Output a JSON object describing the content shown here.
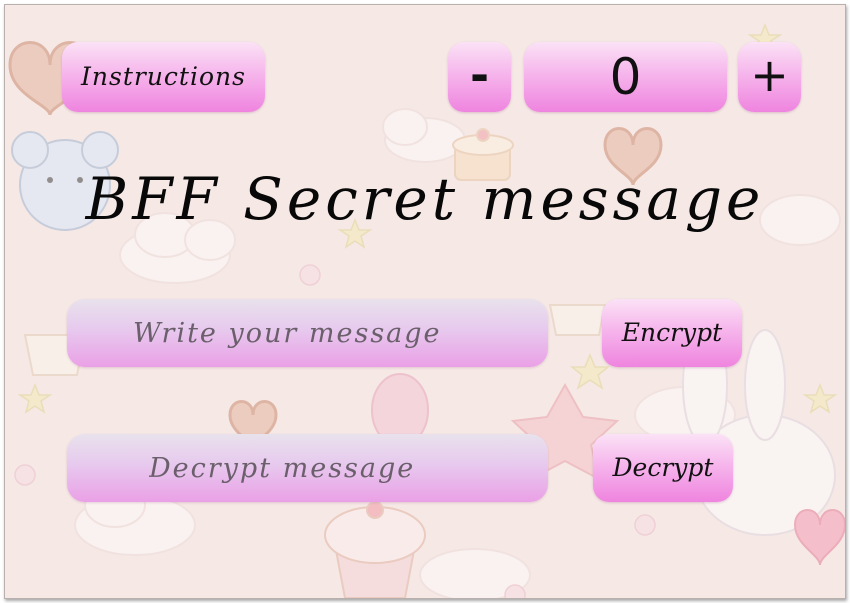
{
  "header": {
    "instructions_label": "Instructions",
    "minus_label": "-",
    "counter_value": "0",
    "plus_label": "+"
  },
  "title": "BFF Secret message",
  "encrypt_row": {
    "placeholder": "Write your message",
    "button_label": "Encrypt"
  },
  "decrypt_row": {
    "placeholder": "Decrypt message",
    "button_label": "Decrypt"
  },
  "colors": {
    "button_top": "#fbe2f6",
    "button_bottom": "#ef84df",
    "field_top": "#e8e2ec",
    "field_bottom": "#eaa0e6",
    "background": "#f4e6e3"
  }
}
